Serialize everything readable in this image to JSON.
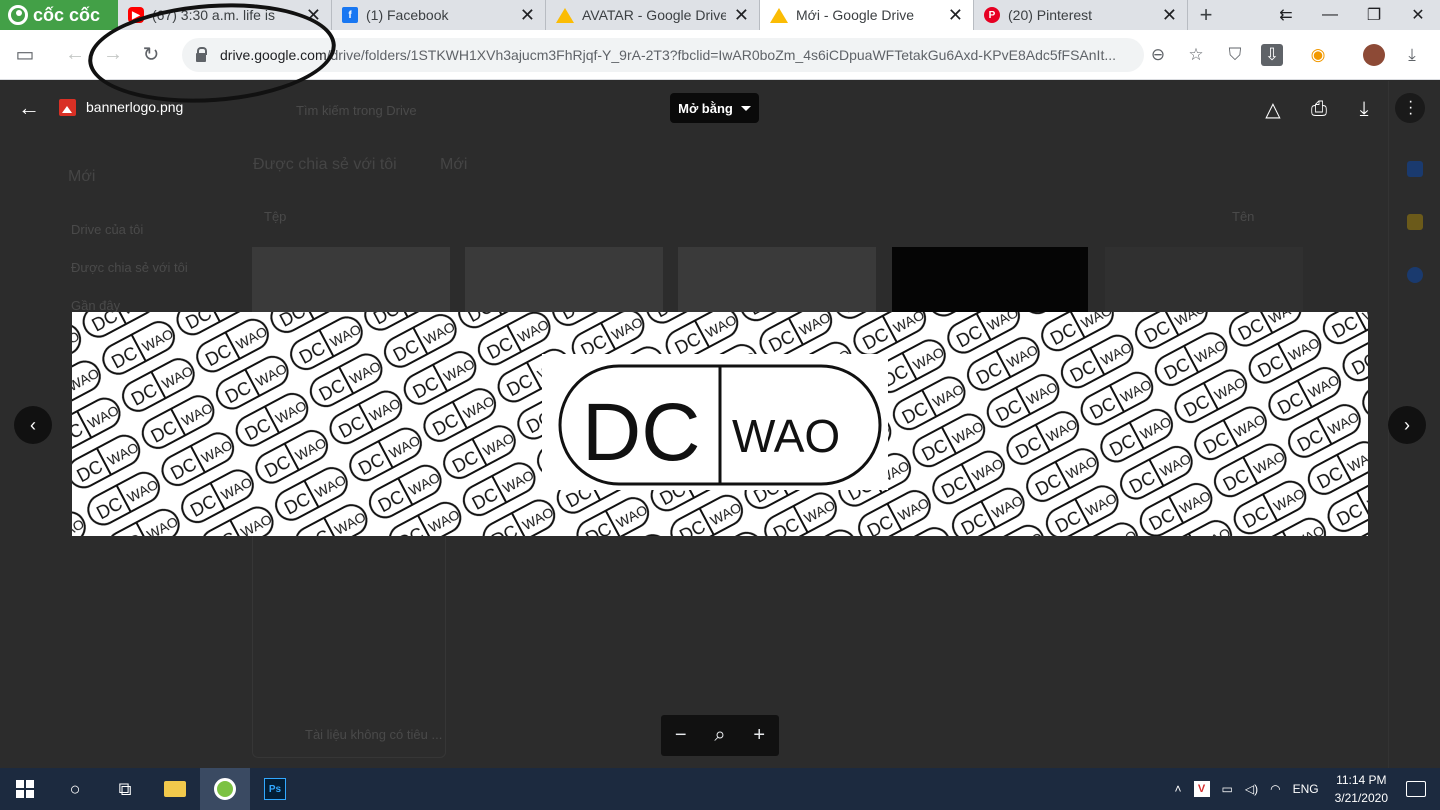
{
  "browser": {
    "brand": "cốc cốc",
    "tabs": [
      {
        "title": "(67) 3:30 a.m. life is",
        "icon": "youtube-icon"
      },
      {
        "title": "(1) Facebook",
        "icon": "facebook-icon"
      },
      {
        "title": "AVATAR - Google Drive",
        "icon": "google-drive-icon"
      },
      {
        "title": "Mới - Google Drive",
        "icon": "google-drive-icon",
        "active": true
      },
      {
        "title": "(20) Pinterest",
        "icon": "pinterest-icon"
      }
    ],
    "url_host": "drive.google.com",
    "url_path": "/drive/folders/1STKWH1XVh3ajucm3FhRjqf-Y_9rA-2T3?fbclid=IwAR0boZm_4s6iCDpuaWFTetakGu6Axd-KPvE8Adc5fFSAnIt..."
  },
  "viewer": {
    "file_name": "bannerlogo.png",
    "open_with_label": "Mở bằng",
    "banner_text_left": "DC",
    "banner_text_right": "WAO"
  },
  "drive_background": {
    "new_button": "Mới",
    "search_placeholder": "Tìm kiếm trong Drive",
    "nav": [
      "Drive của tôi",
      "Được chia sẻ với tôi",
      "Gần đây"
    ],
    "breadcrumb_root": "Được chia sẻ với tôi",
    "breadcrumb_current": "Mới",
    "files_header": "Tệp",
    "sort_label": "Tên",
    "doc_title": "Tài liệu không có tiêu ..."
  },
  "taskbar": {
    "language": "ENG",
    "time": "11:14 PM",
    "date": "3/21/2020",
    "ps_label": "Ps"
  },
  "colors": {
    "brand_green": "#43a047",
    "overlay": "#2c2c2c",
    "taskbar": "#1c2a3f"
  }
}
